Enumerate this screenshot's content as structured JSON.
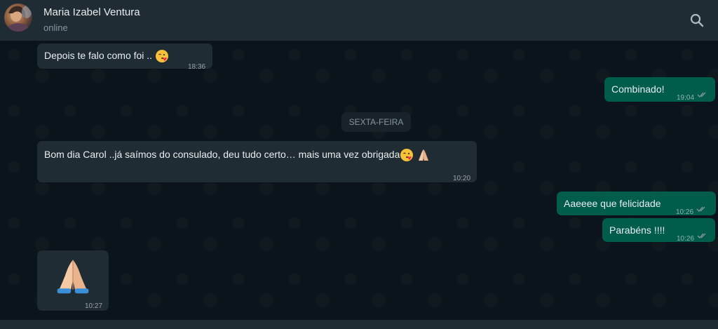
{
  "header": {
    "contact_name": "Maria Izabel Ventura",
    "status": "online",
    "search_icon": "search-icon",
    "avatar_icon": "contact-avatar"
  },
  "date_divider": "SEXTA-FEIRA",
  "messages": [
    {
      "direction": "in",
      "text": "Depois te falo como foi ..",
      "emoji": "kissing-face-with-heart",
      "time": "18:36"
    },
    {
      "direction": "out",
      "text": "Combinado!",
      "time": "19:04",
      "status": "read"
    },
    {
      "direction": "in",
      "text": "Bom dia Carol ..já saímos do consulado, deu tudo certo… mais uma vez obrigada",
      "emoji": "kissing-face-with-heart, folded-hands",
      "time": "10:20"
    },
    {
      "direction": "out",
      "text": "Aaeeee que felicidade",
      "time": "10:26",
      "status": "read"
    },
    {
      "direction": "out",
      "text": "Parabéns !!!!",
      "time": "10:26",
      "status": "read"
    },
    {
      "direction": "in",
      "text": "",
      "emoji": "folded-hands",
      "time": "10:27"
    }
  ],
  "colors": {
    "header_bg": "#202c33",
    "chat_bg": "#0b141a",
    "incoming_bubble": "#202c33",
    "outgoing_bubble": "#005c4b",
    "read_tick": "#8696a0"
  }
}
